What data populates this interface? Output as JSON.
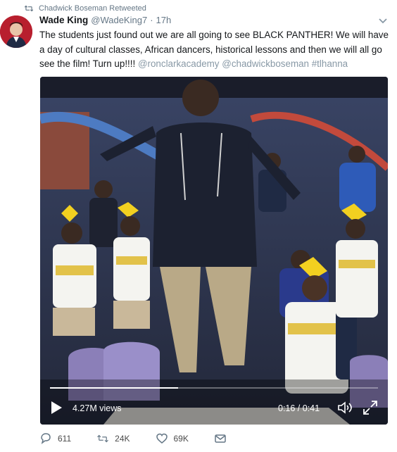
{
  "retweet": {
    "label": "Chadwick Boseman Retweeted",
    "icon": "retweet-icon"
  },
  "author": {
    "name": "Wade King",
    "handle": "@WadeKing7",
    "separator": "·",
    "time": "17h",
    "avatar": "author-avatar"
  },
  "tweet": {
    "text": "The students just found out we are all going to see BLACK PANTHER! We will have a day of cultural classes, African dancers, historical lessons and then we will all go see the film! Turn up!!!!",
    "mention_1": "@ronclarkacademy",
    "mention_2": "@chadwickboseman",
    "hashtag": "#tlhanna"
  },
  "video": {
    "views": "4.27M views",
    "elapsed": "0:16",
    "duration": "0:41",
    "timecode": "0:16 / 0:41",
    "progress_fraction": 0.39
  },
  "actions": {
    "replies": "611",
    "retweets": "24K",
    "likes": "69K"
  },
  "colors": {
    "text": "#14171a",
    "secondary": "#657786",
    "link": "#8899a6",
    "media_bg": "#2b2f3e"
  }
}
